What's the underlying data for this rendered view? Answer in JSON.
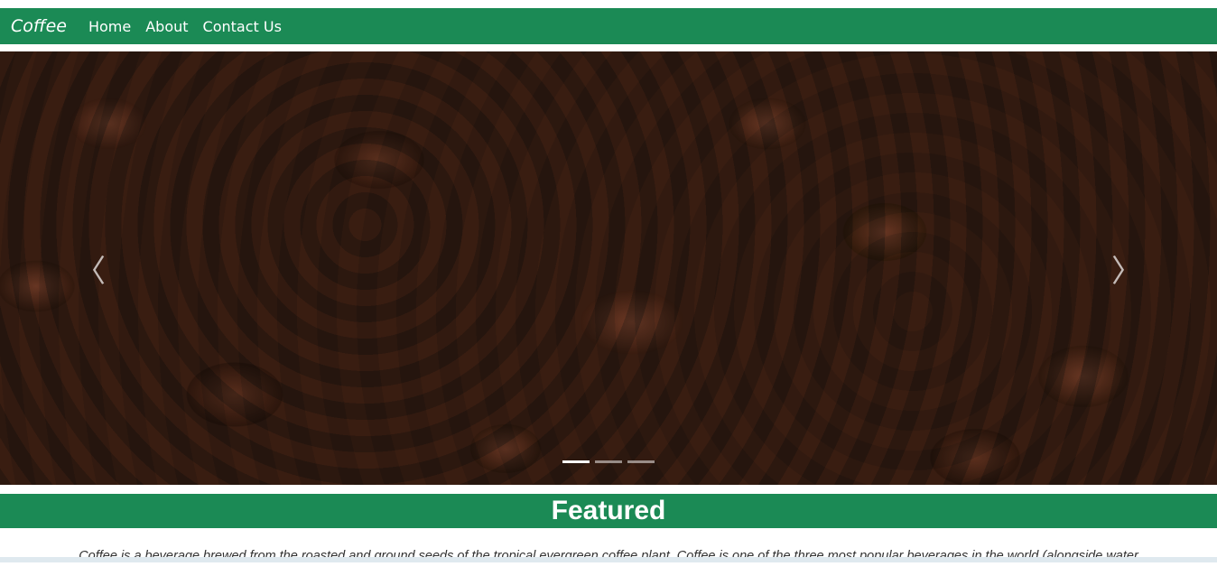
{
  "navbar": {
    "brand": "Coffee",
    "links": [
      "Home",
      "About",
      "Contact Us"
    ],
    "color": "#1b8a55"
  },
  "carousel": {
    "image": "coffee-beans",
    "prev_icon": "chevron-left-icon",
    "next_icon": "chevron-right-icon",
    "prev_glyph": "〈",
    "next_glyph": "〉",
    "indicators": 3,
    "active_indicator": 1
  },
  "featured": {
    "title": "Featured",
    "description": "Coffee is a beverage brewed from the roasted and ground seeds of the tropical evergreen coffee plant. Coffee is one of the three most popular beverages in the world (alongside water"
  }
}
